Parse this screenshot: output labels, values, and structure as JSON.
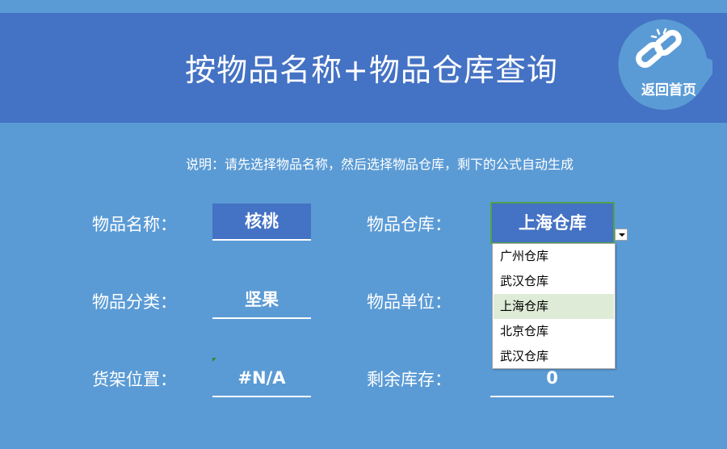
{
  "header": {
    "title": "按物品名称+物品仓库查询",
    "home_label": "返回首页"
  },
  "note": "说明：请先选择物品名称，然后选择物品仓库，剩下的公式自动生成",
  "fields": {
    "name_label": "物品名称：",
    "name_value": "核桃",
    "warehouse_label": "物品仓库：",
    "warehouse_value": "上海仓库",
    "category_label": "物品分类：",
    "category_value": "坚果",
    "unit_label": "物品单位：",
    "shelf_label": "货架位置：",
    "shelf_value": "#N/A",
    "stock_label": "剩余库存：",
    "stock_value": "0"
  },
  "dropdown": {
    "options": [
      "广州仓库",
      "武汉仓库",
      "上海仓库",
      "北京仓库",
      "武汉仓库"
    ],
    "highlighted": "上海仓库"
  },
  "colors": {
    "background": "#5b9bd5",
    "header": "#4472c4",
    "selection_border": "#4ea24e",
    "dropdown_highlight": "#ddebd7"
  }
}
